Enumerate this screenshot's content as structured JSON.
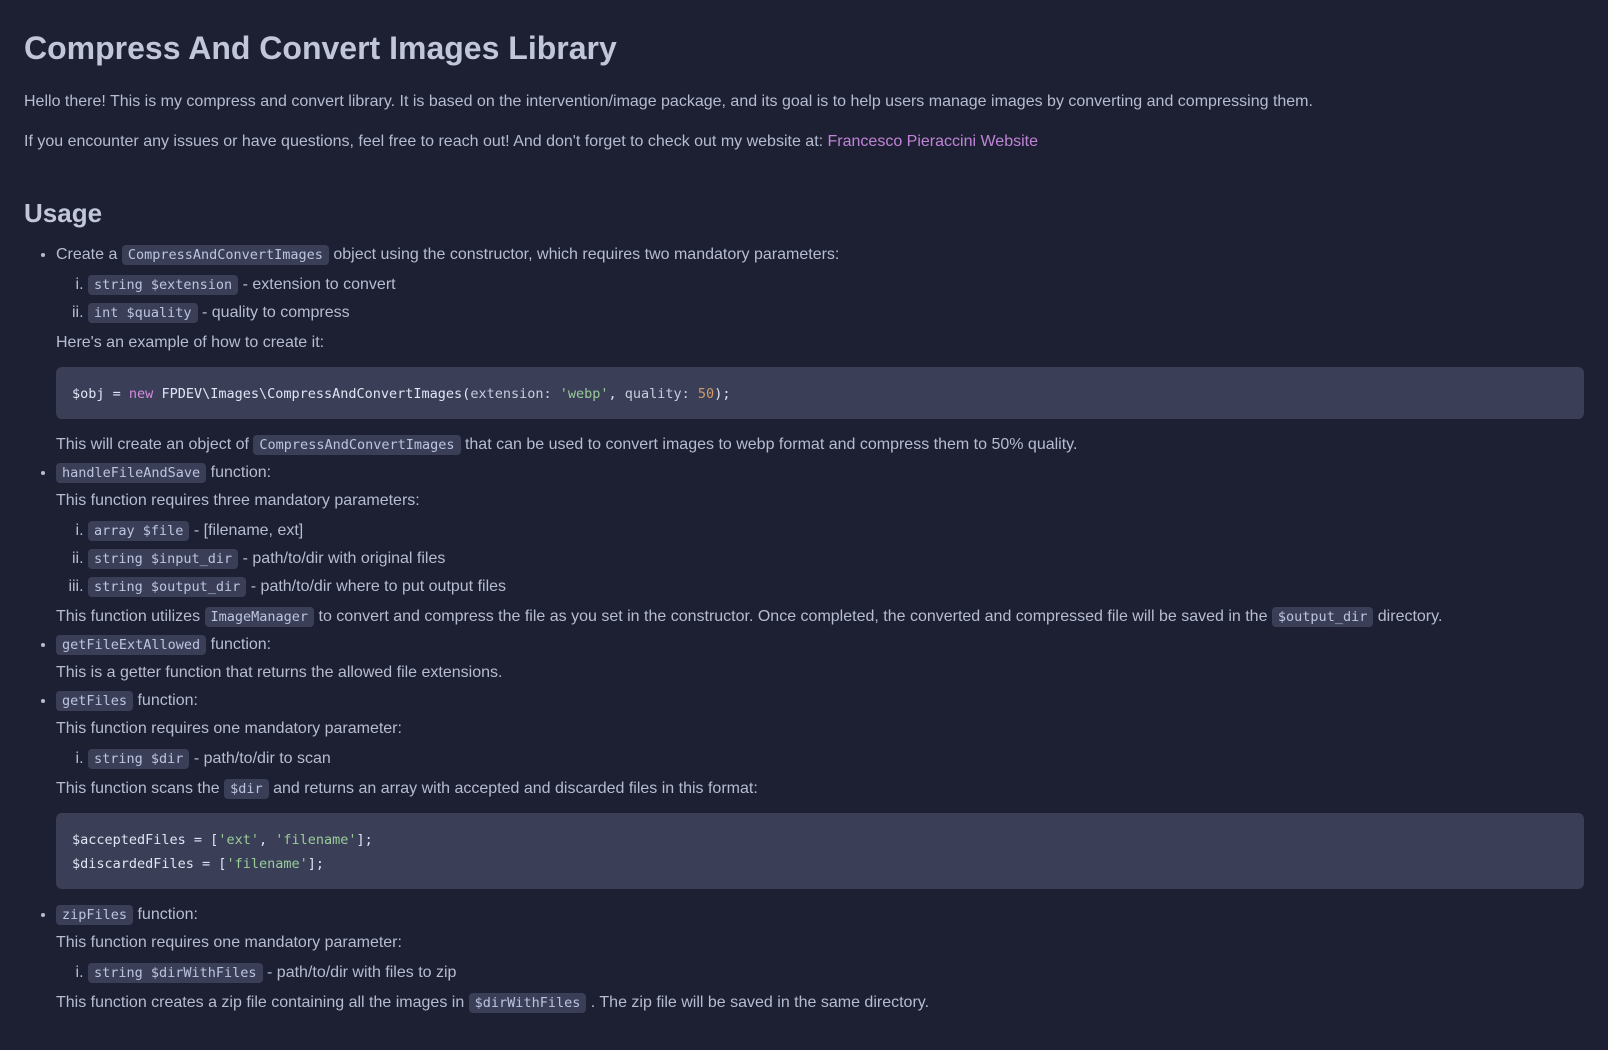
{
  "title": "Compress And Convert Images Library",
  "intro1": "Hello there! This is my compress and convert library. It is based on the intervention/image package, and its goal is to help users manage images by converting and compressing them.",
  "intro2_prefix": "If you encounter any issues or have questions, feel free to reach out! And don't forget to check out my website at: ",
  "intro2_link": "Francesco Pieraccini Website",
  "usage_heading": "Usage",
  "item1": {
    "pre1": "Create a ",
    "code1": "CompressAndConvertImages",
    "post1": " object using the constructor, which requires two mandatory parameters:",
    "params": [
      {
        "code": "string $extension",
        "desc": " - extension to convert"
      },
      {
        "code": "int $quality",
        "desc": " - quality to compress"
      }
    ],
    "example_intro": "Here's an example of how to create it:",
    "codeblock": {
      "var": "$obj",
      "eq": " = ",
      "kw": "new",
      "sp": " ",
      "cls": "FPDEV\\Images\\CompressAndConvertImages",
      "open": "(",
      "k1": "extension: ",
      "v1": "'webp'",
      "comma": ", ",
      "k2": "quality: ",
      "v2": "50",
      "close": ");"
    },
    "after1_pre": "This will create an object of ",
    "after1_code": "CompressAndConvertImages",
    "after1_post": " that can be used to convert images to webp format and compress them to 50% quality."
  },
  "item2": {
    "fn_code": "handleFileAndSave",
    "fn_label": " function:",
    "requires": "This function requires three mandatory parameters:",
    "params": [
      {
        "code": "array $file",
        "desc": " - [filename, ext]"
      },
      {
        "code": "string $input_dir",
        "desc": " - path/to/dir with original files"
      },
      {
        "code": "string $output_dir",
        "desc": " - path/to/dir where to put output files"
      }
    ],
    "tail_pre": "This function utilizes ",
    "tail_code1": "ImageManager",
    "tail_mid": " to convert and compress the file as you set in the constructor. Once completed, the converted and compressed file will be saved in the ",
    "tail_code2": "$output_dir",
    "tail_post": " directory."
  },
  "item3": {
    "fn_code": "getFileExtAllowed",
    "fn_label": " function:",
    "desc": "This is a getter function that returns the allowed file extensions."
  },
  "item4": {
    "fn_code": "getFiles",
    "fn_label": " function:",
    "requires": "This function requires one mandatory parameter:",
    "params": [
      {
        "code": "string $dir",
        "desc": " - path/to/dir to scan"
      }
    ],
    "tail_pre": "This function scans the ",
    "tail_code": "$dir",
    "tail_post": " and returns an array with accepted and discarded files in this format:",
    "codeblock": {
      "l1_var": "$acceptedFiles",
      "l1_eq": " = [",
      "l1_s1": "'ext'",
      "l1_c": ", ",
      "l1_s2": "'filename'",
      "l1_end": "];",
      "l2_var": "$discardedFiles",
      "l2_eq": " = [",
      "l2_s1": "'filename'",
      "l2_end": "];"
    }
  },
  "item5": {
    "fn_code": "zipFiles",
    "fn_label": " function:",
    "requires": "This function requires one mandatory parameter:",
    "params": [
      {
        "code": "string $dirWithFiles",
        "desc": " - path/to/dir with files to zip"
      }
    ],
    "tail_pre": "This function creates a zip file containing all the images in ",
    "tail_code": "$dirWithFiles",
    "tail_post": ". The zip file will be saved in the same directory."
  }
}
